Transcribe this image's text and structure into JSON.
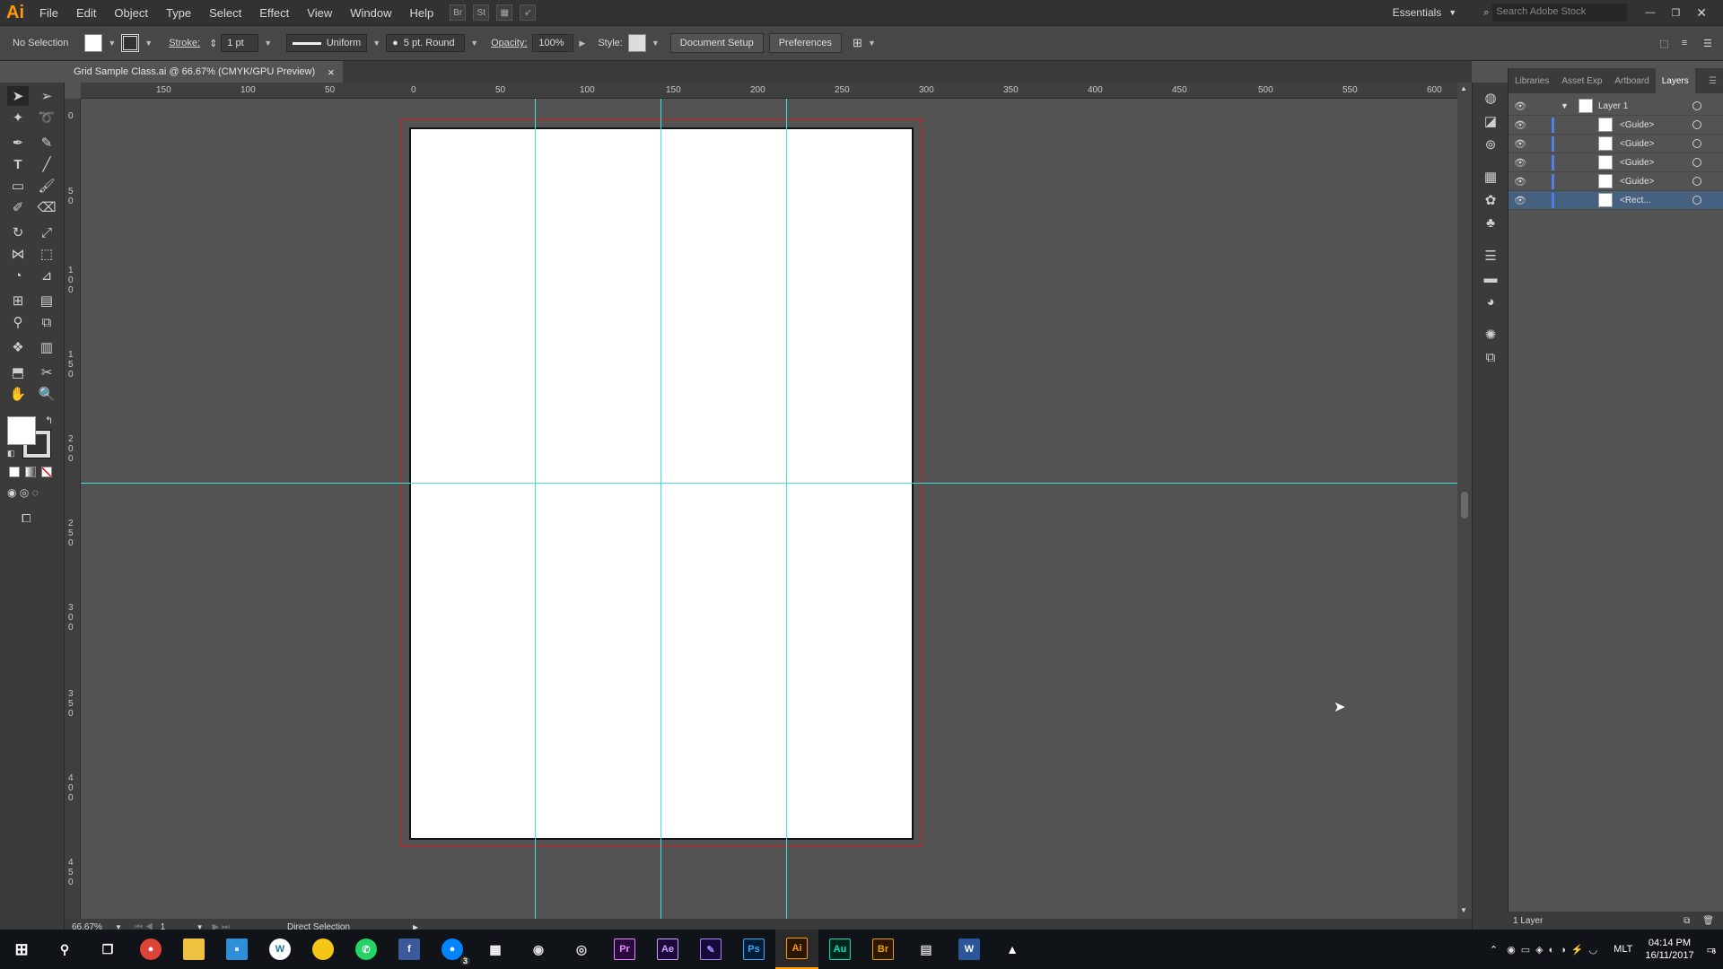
{
  "app": {
    "logo": "Ai",
    "workspace": "Essentials",
    "search_placeholder": "Search Adobe Stock"
  },
  "menu": [
    "File",
    "Edit",
    "Object",
    "Type",
    "Select",
    "Effect",
    "View",
    "Window",
    "Help"
  ],
  "app_icons": [
    "Br",
    "St"
  ],
  "options": {
    "selection": "No Selection",
    "stroke_label": "Stroke:",
    "stroke_value": "1 pt",
    "uniform": "Uniform",
    "brush": "5 pt. Round",
    "opacity_label": "Opacity:",
    "opacity_value": "100%",
    "style_label": "Style:",
    "doc_setup": "Document Setup",
    "preferences": "Preferences"
  },
  "document": {
    "tab_title": "Grid Sample Class.ai @ 66.67% (CMYK/GPU Preview)",
    "close": "×"
  },
  "ruler_h": [
    "150",
    "100",
    "50",
    "0",
    "50",
    "100",
    "150",
    "200",
    "250",
    "300",
    "350",
    "400",
    "450",
    "500",
    "550",
    "600"
  ],
  "ruler_v": [
    "0",
    "5 0",
    "1 0 0",
    "1 5 0",
    "2 0 0",
    "2 5 0",
    "3 0 0",
    "3 5 0",
    "4 0 0",
    "4 5 0"
  ],
  "status": {
    "zoom": "66.67%",
    "artboard": "1",
    "tool": "Direct Selection"
  },
  "panel": {
    "tabs": [
      "Libraries",
      "Asset Exp",
      "Artboard",
      "Layers"
    ],
    "layer": "Layer 1",
    "sublayers": [
      "<Guide>",
      "<Guide>",
      "<Guide>",
      "<Guide>",
      "<Rect..."
    ],
    "footer": "1 Layer"
  },
  "taskbar": {
    "time": "04:14 PM",
    "date": "16/11/2017",
    "lang": "MLT",
    "notif_count": "6",
    "messenger_badge": "3",
    "apps": [
      "chrome",
      "explorer",
      "app",
      "wordpress",
      "app",
      "whatsapp",
      "app",
      "messenger",
      "calendar",
      "app",
      "app",
      "Pr",
      "Ae",
      "app",
      "Ps",
      "Ai",
      "Au",
      "Br",
      "app",
      "W",
      "photos"
    ]
  }
}
